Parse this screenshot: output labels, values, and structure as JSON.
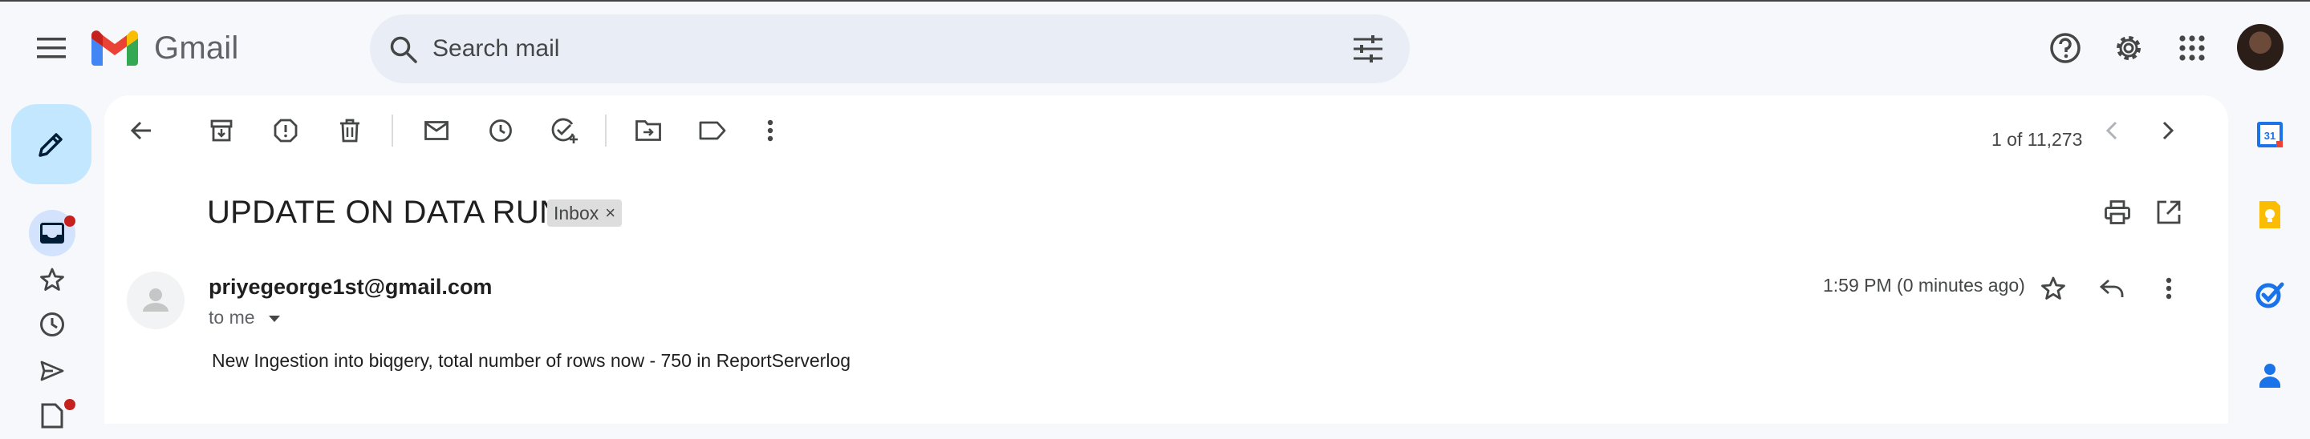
{
  "app": {
    "name": "Gmail"
  },
  "search": {
    "placeholder": "Search mail"
  },
  "toolbar": {
    "pager": "1 of 11,273"
  },
  "message": {
    "subject": "UPDATE ON DATA RUN",
    "label": "Inbox",
    "label_remove": "×",
    "sender": "priyegeorge1st@gmail.com",
    "recipient": "to me",
    "time": "1:59 PM (0 minutes ago)",
    "body": "New Ingestion into biqgery, total number of rows now - 750 in ReportServerlog"
  },
  "side_apps": {
    "calendar_day": "31"
  },
  "colors": {
    "background": "#f6f8fc",
    "search_bg": "#e9eef6",
    "compose_bg": "#c2e7ff",
    "notification_dot": "#c5221f",
    "calendar_blue": "#1a73e8",
    "keep_yellow": "#fbbc04",
    "tasks_blue": "#1a73e8"
  }
}
